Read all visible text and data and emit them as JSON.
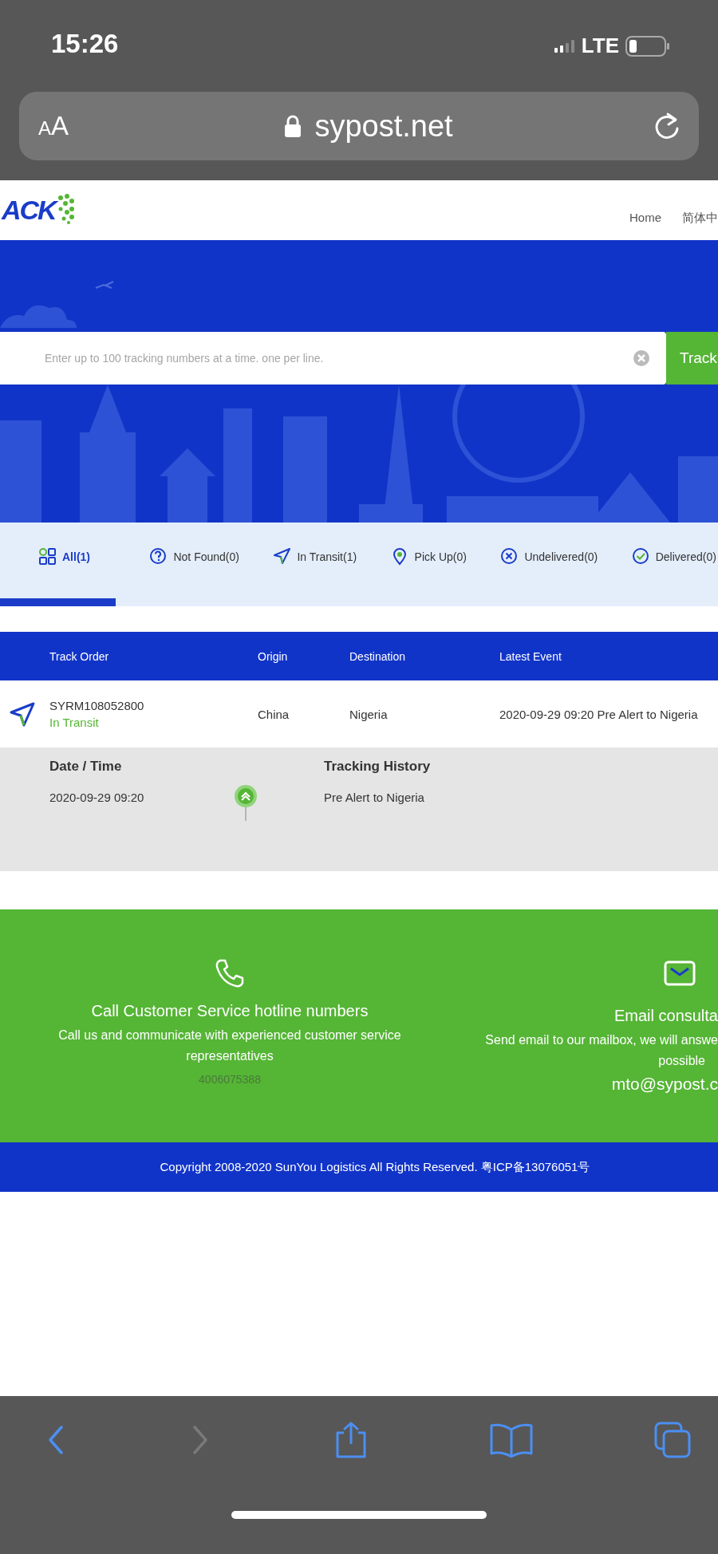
{
  "status_bar": {
    "time": "15:26",
    "network": "LTE"
  },
  "browser": {
    "text_size_label": "AA",
    "url": "sypost.net"
  },
  "site_header": {
    "logo_text": "ACK",
    "nav": [
      {
        "label": "Home"
      },
      {
        "label": "简体中"
      }
    ]
  },
  "search": {
    "placeholder": "Enter up to 100 tracking numbers at a time. one per line.",
    "button": "Track"
  },
  "tabs": [
    {
      "kind": "all",
      "label": "All(1)",
      "selected": true
    },
    {
      "kind": "not_found",
      "label": "Not Found(0)",
      "selected": false
    },
    {
      "kind": "in_transit",
      "label": "In Transit(1)",
      "selected": false
    },
    {
      "kind": "pick_up",
      "label": "Pick Up(0)",
      "selected": false
    },
    {
      "kind": "undelivered",
      "label": "Undelivered(0)",
      "selected": false
    },
    {
      "kind": "delivered",
      "label": "Delivered(0)",
      "selected": false
    }
  ],
  "table": {
    "columns": [
      "Track Order",
      "Origin",
      "Destination",
      "Latest Event"
    ],
    "rows": [
      {
        "order": "SYRM108052800",
        "status": "In Transit",
        "origin": "China",
        "destination": "Nigeria",
        "latest_event": "2020-09-29 09:20 Pre Alert to Nigeria",
        "expanded": true,
        "history_headers": [
          "Date / Time",
          "Tracking History"
        ],
        "history": [
          {
            "time": "2020-09-29 09:20",
            "description": "Pre Alert to Nigeria"
          }
        ]
      }
    ]
  },
  "contacts": [
    {
      "kind": "phone",
      "title": "Call Customer Service hotline numbers",
      "description": "Call us and communicate with experienced customer service representatives",
      "contact": "4006075388"
    },
    {
      "kind": "email",
      "title": "Email consulta",
      "description": "Send email to our mailbox, we will answe",
      "description_2": "possible",
      "contact": "mto@sypost.c"
    }
  ],
  "copyright": "Copyright 2008-2020 SunYou Logistics All Rights Reserved. 粤ICP备13076051号",
  "toolbar": [
    {
      "kind": "back",
      "disabled": false
    },
    {
      "kind": "forward",
      "disabled": true
    },
    {
      "kind": "share",
      "disabled": false
    },
    {
      "kind": "bookmarks",
      "disabled": false
    },
    {
      "kind": "tabs",
      "disabled": false
    }
  ]
}
